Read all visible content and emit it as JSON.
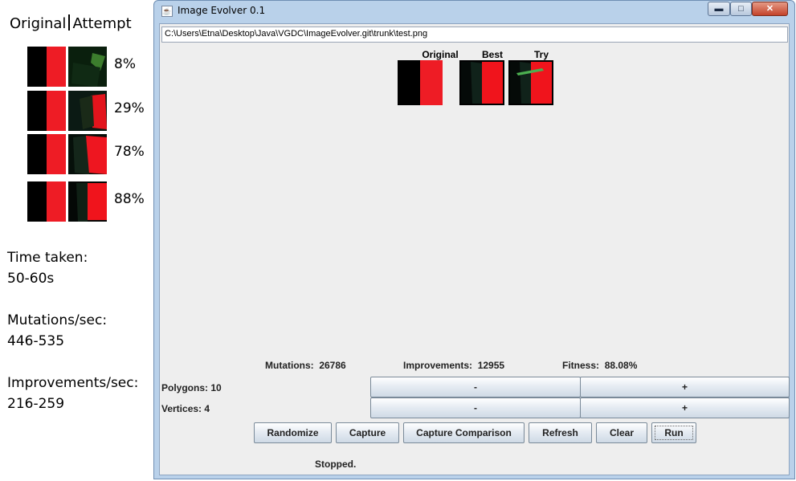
{
  "annotation": {
    "header_left": "Original",
    "header_right": "Attempt",
    "rows": [
      {
        "percent": "8%"
      },
      {
        "percent": "29%"
      },
      {
        "percent": "78%"
      },
      {
        "percent": "88%"
      }
    ],
    "stats": [
      {
        "label": "Time taken:",
        "value": "50-60s"
      },
      {
        "label": "Mutations/sec:",
        "value": "446-535"
      },
      {
        "label": "Improvements/sec:",
        "value": "216-259"
      }
    ]
  },
  "window": {
    "title": "Image Evolver 0.1",
    "icon": "java-cup-icon",
    "controls": {
      "minimize": "minimize-icon",
      "maximize": "maximize-icon",
      "close": "close-icon"
    }
  },
  "path": "C:\\Users\\Etna\\Desktop\\Java\\VGDC\\ImageEvolver.git\\trunk\\test.png",
  "preview": {
    "original_label": "Original",
    "best_label": "Best",
    "try_label": "Try"
  },
  "stats": {
    "mutations_label": "Mutations:",
    "mutations_value": "26786",
    "improvements_label": "Improvements:",
    "improvements_value": "12955",
    "fitness_label": "Fitness:",
    "fitness_value": "88.08%"
  },
  "polygons": {
    "label": "Polygons: 10",
    "minus": "-",
    "plus": "+"
  },
  "vertices": {
    "label": "Vertices: 4",
    "minus": "-",
    "plus": "+"
  },
  "buttons": {
    "randomize": "Randomize",
    "capture": "Capture",
    "capture_comparison": "Capture Comparison",
    "refresh": "Refresh",
    "clear": "Clear",
    "run": "Run"
  },
  "status": "Stopped.",
  "colors": {
    "accent_red": "#ee1c25",
    "polygon_green": "#3c9a3c",
    "window_frame": "#b9d1ea"
  }
}
